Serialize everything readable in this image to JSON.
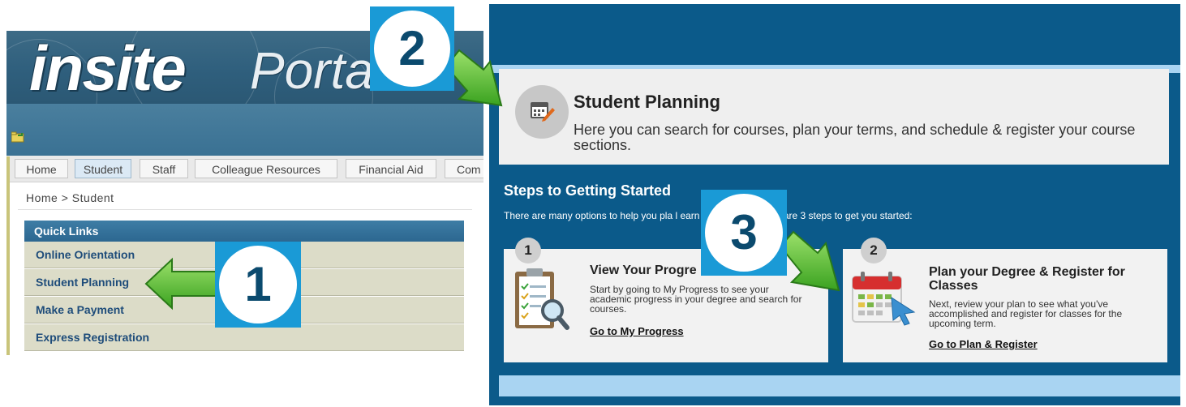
{
  "portal": {
    "logo_in": "in",
    "logo_site": "site",
    "logo_portal": "Portal",
    "tabs": [
      "Home",
      "Student",
      "Staff",
      "Colleague Resources",
      "Financial Aid",
      "Com"
    ],
    "breadcrumb": "Home >  Student",
    "quick_links": {
      "title": "Quick Links",
      "items": [
        "Online Orientation",
        "Student Planning",
        "Make a Payment",
        "Express Registration"
      ]
    }
  },
  "planning": {
    "title": "Student Planning",
    "description": "Here you can search for courses, plan your terms, and schedule & register your course sections.",
    "steps_title": "Steps to Getting Started",
    "steps_intro": "There are many options to help you pla                                        l earn your degree. Here are 3 steps to get you started:",
    "steps": [
      {
        "number": "1",
        "title": "View Your Progre",
        "description": "Start by going to My Progress to see your academic progress in your degree and search for courses.",
        "link": "Go to My Progress",
        "icon": "clipboard-icon"
      },
      {
        "number": "2",
        "title": "Plan your Degree & Register for Classes",
        "description": "Next, review your plan to see what you've accomplished and register for classes for the upcoming term.",
        "link": "Go to Plan & Register",
        "icon": "calendar-icon"
      }
    ]
  },
  "callouts": [
    "1",
    "2",
    "3"
  ],
  "colors": {
    "badge": "#1a9ad6",
    "arrow": "#4cb82a",
    "planning_bg": "#0b5a8a",
    "link_blue": "#1e4c7a"
  }
}
